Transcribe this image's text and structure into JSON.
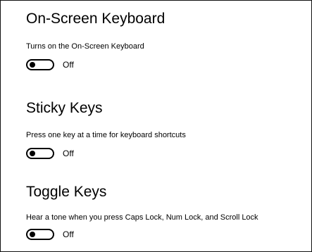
{
  "settings": [
    {
      "title": "On-Screen Keyboard",
      "description": "Turns on the On-Screen Keyboard",
      "state_label": "Off",
      "enabled": false
    },
    {
      "title": "Sticky Keys",
      "description": "Press one key at a time for keyboard shortcuts",
      "state_label": "Off",
      "enabled": false
    },
    {
      "title": "Toggle Keys",
      "description": "Hear a tone when you press Caps Lock, Num Lock, and Scroll Lock",
      "state_label": "Off",
      "enabled": false
    }
  ],
  "colors": {
    "text": "#000000",
    "background": "#ffffff",
    "toggle_border": "#000000"
  }
}
